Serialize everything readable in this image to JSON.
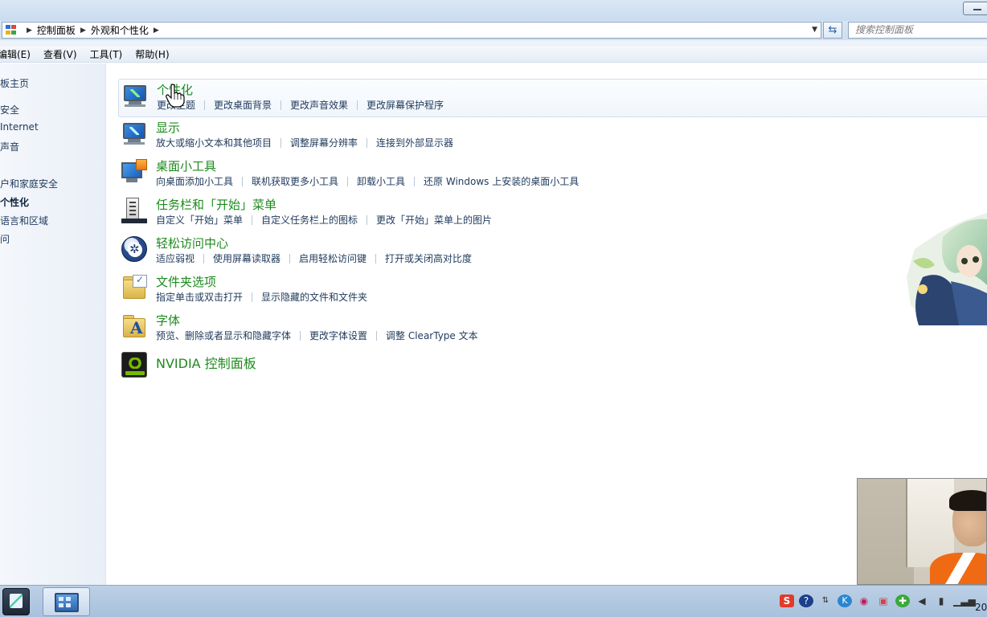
{
  "address": {
    "breadcrumbs": [
      "控制面板",
      "外观和个性化"
    ],
    "search_placeholder": "搜索控制面板"
  },
  "menu": [
    "编辑(E)",
    "查看(V)",
    "工具(T)",
    "帮助(H)"
  ],
  "leftnav": [
    {
      "label": "板主页",
      "bold": false
    },
    {
      "label": "安全",
      "bold": false
    },
    {
      "label": "Internet",
      "bold": false
    },
    {
      "label": "声音",
      "bold": false
    },
    {
      "label": "户和家庭安全",
      "bold": false
    },
    {
      "label": "个性化",
      "bold": true
    },
    {
      "label": "语言和区域",
      "bold": false
    },
    {
      "label": "问",
      "bold": false
    }
  ],
  "categories": [
    {
      "title": "个性化",
      "icon": "personalization-icon",
      "links": [
        "更改主题",
        "更改桌面背景",
        "更改声音效果",
        "更改屏幕保护程序"
      ]
    },
    {
      "title": "显示",
      "icon": "display-icon",
      "links": [
        "放大或缩小文本和其他项目",
        "调整屏幕分辨率",
        "连接到外部显示器"
      ]
    },
    {
      "title": "桌面小工具",
      "icon": "gadgets-icon",
      "links": [
        "向桌面添加小工具",
        "联机获取更多小工具",
        "卸载小工具",
        "还原 Windows 上安装的桌面小工具"
      ]
    },
    {
      "title": "任务栏和「开始」菜单",
      "icon": "taskbar-icon",
      "links": [
        "自定义「开始」菜单",
        "自定义任务栏上的图标",
        "更改「开始」菜单上的图片"
      ]
    },
    {
      "title": "轻松访问中心",
      "icon": "ease-of-access-icon",
      "links": [
        "适应弱视",
        "使用屏幕读取器",
        "启用轻松访问键",
        "打开或关闭高对比度"
      ]
    },
    {
      "title": "文件夹选项",
      "icon": "folder-options-icon",
      "links": [
        "指定单击或双击打开",
        "显示隐藏的文件和文件夹"
      ]
    },
    {
      "title": "字体",
      "icon": "fonts-icon",
      "links": [
        "预览、删除或者显示和隐藏字体",
        "更改字体设置",
        "调整 ClearType 文本"
      ]
    },
    {
      "title": "NVIDIA 控制面板",
      "icon": "nvidia-icon",
      "links": []
    }
  ],
  "taskbar": {
    "tray_icons": [
      "sogou-ime-icon",
      "help-icon",
      "arrows-icon",
      "k-icon",
      "record-icon",
      "tv-icon",
      "network-app-icon",
      "volume-icon",
      "usb-icon",
      "signal-icon"
    ],
    "clock_fragment": "20"
  },
  "colors": {
    "category_title": "#1d8a1d",
    "link": "#1e395b"
  }
}
